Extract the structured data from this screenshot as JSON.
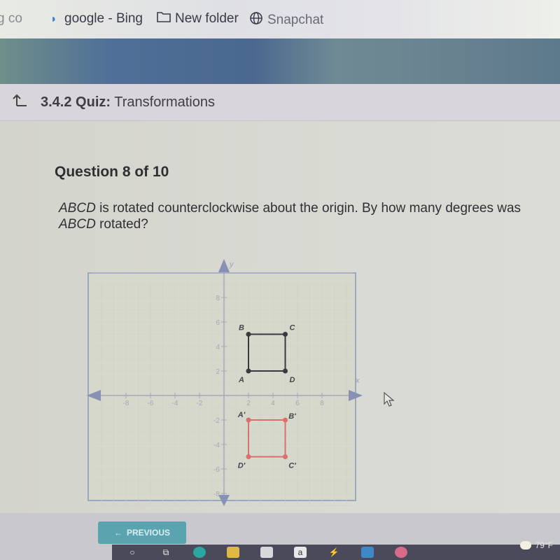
{
  "browser": {
    "bookmarks": [
      {
        "label": "g co",
        "icon": "page-icon"
      },
      {
        "label": "google - Bing",
        "icon": "bing-icon"
      },
      {
        "label": "New folder",
        "icon": "folder-icon"
      },
      {
        "label": "Snapchat",
        "icon": "globe-icon"
      }
    ]
  },
  "quiz": {
    "back_icon": "back-arrow-icon",
    "section": "3.4.2",
    "type": "Quiz:",
    "name": "Transformations"
  },
  "question": {
    "number_label": "Question 8 of 10",
    "text_part1": "ABCD",
    "text_part2": " is rotated counterclockwise about the origin. By how many degrees was ",
    "text_part3": "ABCD",
    "text_part4": " rotated?"
  },
  "graph": {
    "x_axis_label": "x",
    "y_axis_label": "y",
    "x_ticks": [
      "-8",
      "-6",
      "-4",
      "-2",
      "2",
      "4",
      "6",
      "8"
    ],
    "y_ticks": [
      "8",
      "6",
      "4",
      "2",
      "-2",
      "-4",
      "-6",
      "-8"
    ],
    "range": [
      -10,
      10
    ],
    "original": {
      "color": "#3a3a3e",
      "points": [
        {
          "label": "A",
          "x": 2,
          "y": 2
        },
        {
          "label": "B",
          "x": 2,
          "y": 5
        },
        {
          "label": "C",
          "x": 5,
          "y": 5
        },
        {
          "label": "D",
          "x": 5,
          "y": 2
        }
      ]
    },
    "image": {
      "color": "#d9706a",
      "points": [
        {
          "label": "A'",
          "x": 2,
          "y": -2
        },
        {
          "label": "B'",
          "x": 5,
          "y": -2
        },
        {
          "label": "C'",
          "x": 5,
          "y": -5
        },
        {
          "label": "D'",
          "x": 2,
          "y": -5
        }
      ]
    }
  },
  "nav": {
    "previous_label": "PREVIOUS"
  },
  "taskbar": {
    "icons": [
      "search-icon",
      "task-view-icon",
      "edge-icon",
      "file-explorer-icon",
      "store-icon",
      "amazon-icon",
      "app-icon",
      "mail-icon",
      "photos-icon"
    ],
    "amazon_glyph": "a",
    "weather": "79°F"
  }
}
